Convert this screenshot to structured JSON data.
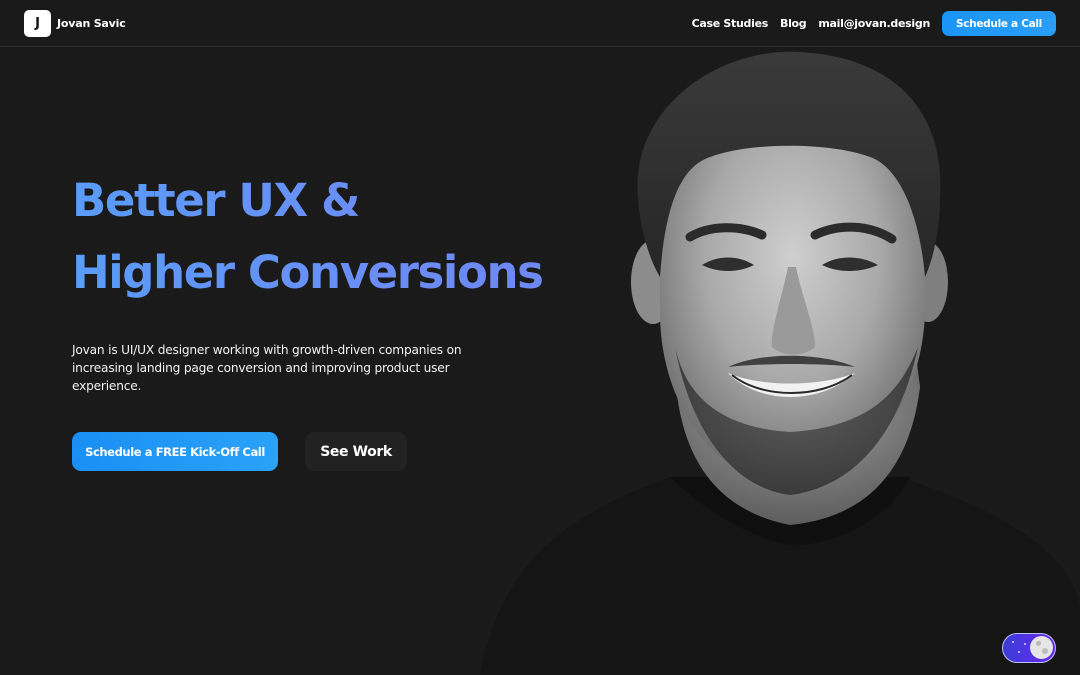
{
  "header": {
    "logo_letter": "J",
    "brand_name": "Jovan Savic",
    "nav": [
      {
        "label": "Case Studies"
      },
      {
        "label": "Blog"
      },
      {
        "label": "mail@jovan.design"
      }
    ],
    "cta_label": "Schedule a Call"
  },
  "hero": {
    "headline_line1": "Better UX &",
    "headline_line2": "Higher Conversions",
    "intro": "Jovan is UI/UX designer working with growth-driven companies on increasing landing page conversion and improving product user experience.",
    "primary_button": "Schedule a FREE Kick-Off Call",
    "secondary_button": "See Work"
  },
  "portrait": {
    "subject": "black-and-white portrait of smiling man"
  },
  "theme_toggle": {
    "mode": "dark"
  },
  "colors": {
    "background": "#1a1a1a",
    "accent_blue": "#1a96f6",
    "headline_gradient_start": "#5a9cf8",
    "headline_gradient_end": "#6f86f3",
    "toggle_purple": "#6a2cf0"
  }
}
